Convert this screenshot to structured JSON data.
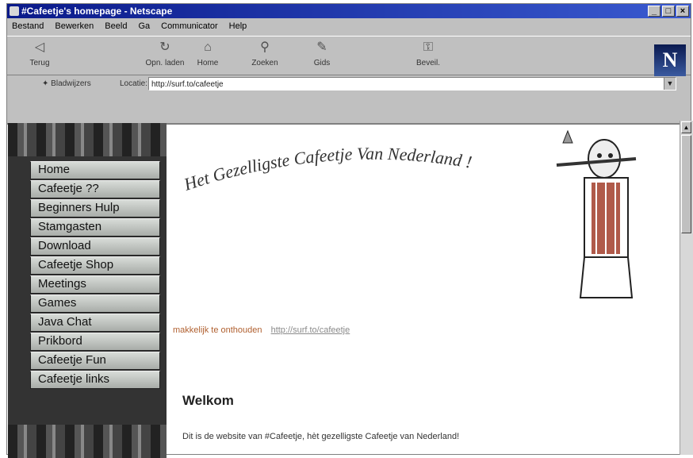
{
  "window": {
    "title": "#Cafeetje's homepage - Netscape",
    "controls": [
      "_",
      "□",
      "×"
    ]
  },
  "menubar": {
    "items": [
      "Bestand",
      "Bewerken",
      "Beeld",
      "Ga",
      "Communicator",
      "Help"
    ]
  },
  "toolbar": {
    "buttons": [
      {
        "label": "Terug",
        "icon": "back-arrow-icon"
      },
      {
        "label": "Opn. laden",
        "icon": "reload-icon"
      },
      {
        "label": "Home",
        "icon": "home-icon"
      },
      {
        "label": "Zoeken",
        "icon": "search-icon"
      },
      {
        "label": "Gids",
        "icon": "guide-icon"
      },
      {
        "label": "Beveil.",
        "icon": "security-icon"
      }
    ],
    "logo": "N"
  },
  "location": {
    "bookmarks_label": "Bladwijzers",
    "location_label": "Locatie:",
    "url": "http://surf.to/cafeetje"
  },
  "sidebar": {
    "items": [
      "Home",
      "Cafeetje ??",
      "Beginners Hulp",
      "Stamgasten",
      "Download",
      "Cafeetje Shop",
      "Meetings",
      "Games",
      "Java Chat",
      "Prikbord",
      "Cafeetje Fun",
      "Cafeetje links"
    ]
  },
  "main": {
    "headline": "Het Gezelligste Cafeetje Van Nederland !",
    "tagline_text": "makkelijk te onthouden",
    "tagline_link": "http://surf.to/cafeetje",
    "welcome_heading": "Welkom",
    "intro_text": "Dit is de website van #Cafeetje, hèt gezelligste Cafeetje van Nederland!"
  },
  "colors": {
    "titlebar": "#0a1a8a",
    "chrome": "#c0c0c0",
    "tagline": "#b06030",
    "sidebar_bg": "#333333"
  }
}
